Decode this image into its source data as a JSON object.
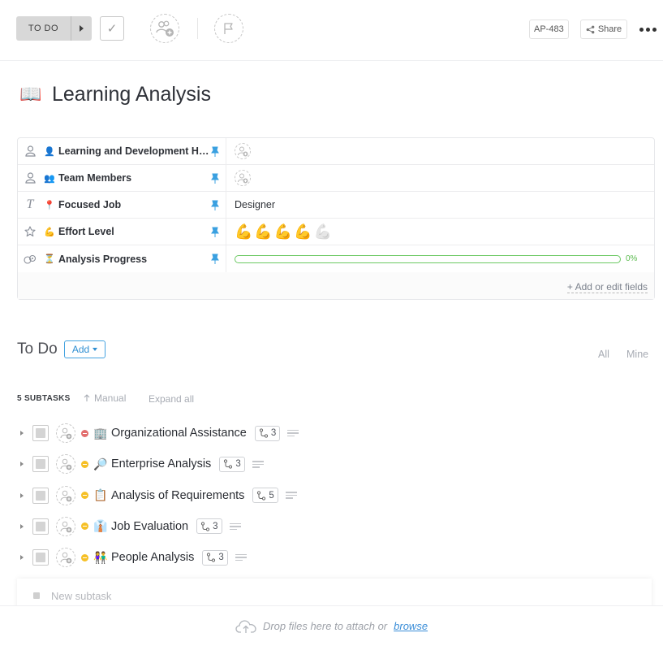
{
  "toolbar": {
    "status_label": "TO DO",
    "task_id": "AP-483",
    "share_label": "Share"
  },
  "task": {
    "emoji": "📖",
    "title": "Learning Analysis"
  },
  "fields": [
    {
      "type_icon": "person-icon",
      "emoji": "👤",
      "name": "Learning and Development Head",
      "value_kind": "assignee"
    },
    {
      "type_icon": "person-icon",
      "emoji": "👥",
      "name": "Team Members",
      "value_kind": "assignee"
    },
    {
      "type_icon": "text-icon",
      "emoji": "📍",
      "name": "Focused Job",
      "value_kind": "text",
      "value": "Designer"
    },
    {
      "type_icon": "star-icon",
      "emoji": "💪",
      "name": "Effort Level",
      "value_kind": "rating",
      "rating": 4,
      "rating_max": 5,
      "rating_emoji": "💪"
    },
    {
      "type_icon": "progress-icon",
      "emoji": "⏳",
      "name": "Analysis Progress",
      "value_kind": "progress",
      "progress_label": "0%",
      "progress": 0
    }
  ],
  "fields_footer": {
    "edit_label": "+ Add or edit fields"
  },
  "checklist": {
    "title": "To Do",
    "add_label": "Add",
    "filter_all": "All",
    "filter_mine": "Mine",
    "subtask_count": "5 SUBTASKS",
    "sort_label": "Manual",
    "expand_label": "Expand all"
  },
  "subtasks": [
    {
      "priority_color": "#e26d6d",
      "emoji": "🏢",
      "name": "Organizational Assistance",
      "count": "3"
    },
    {
      "priority_color": "#f6c026",
      "emoji": "🔎",
      "name": "Enterprise Analysis",
      "count": "3"
    },
    {
      "priority_color": "#f6c026",
      "emoji": "📋",
      "name": "Analysis of Requirements",
      "count": "5"
    },
    {
      "priority_color": "#f6c026",
      "emoji": "👔",
      "name": "Job Evaluation",
      "count": "3"
    },
    {
      "priority_color": "#f6c026",
      "emoji": "👫",
      "name": "People Analysis",
      "count": "3"
    }
  ],
  "new_subtask": {
    "placeholder": "New subtask"
  },
  "dropzone": {
    "text": "Drop files here to attach or",
    "browse_label": "browse"
  },
  "colors": {
    "accent": "#2f8fd2",
    "pin": "#3aa0e0",
    "progress": "#6dc964"
  }
}
